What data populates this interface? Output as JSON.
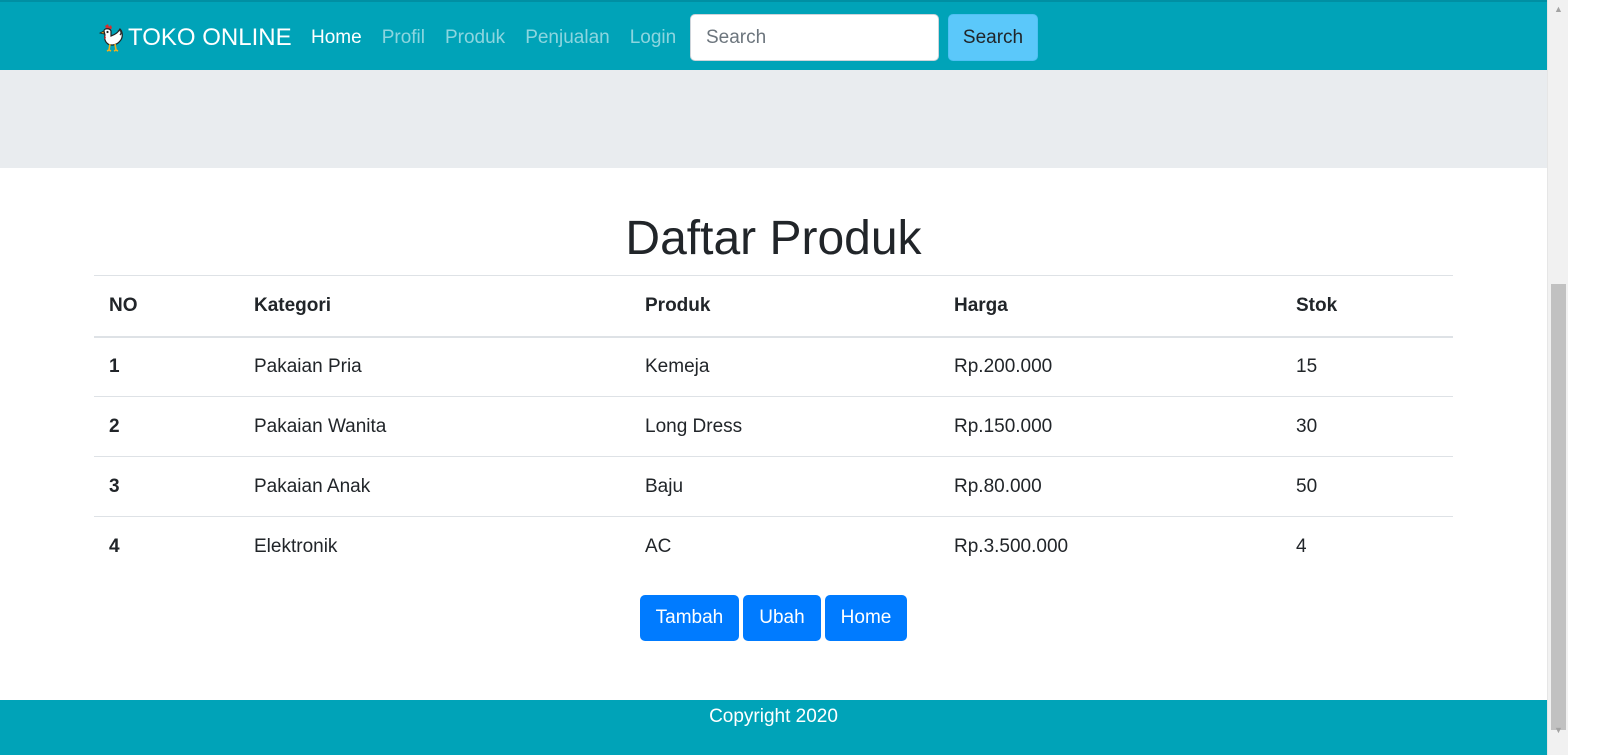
{
  "navbar": {
    "brand": "TOKO ONLINE",
    "logo_icon": "rooster-icon",
    "links": [
      {
        "label": "Home",
        "active": true
      },
      {
        "label": "Profil",
        "active": false
      },
      {
        "label": "Produk",
        "active": false
      },
      {
        "label": "Penjualan",
        "active": false
      },
      {
        "label": "Login",
        "active": false
      }
    ],
    "search_placeholder": "Search",
    "search_value": "",
    "search_button": "Search"
  },
  "main": {
    "title": "Daftar Produk",
    "table": {
      "headers": [
        "NO",
        "Kategori",
        "Produk",
        "Harga",
        "Stok"
      ],
      "rows": [
        [
          "1",
          "Pakaian Pria",
          "Kemeja",
          "Rp.200.000",
          "15"
        ],
        [
          "2",
          "Pakaian Wanita",
          "Long Dress",
          "Rp.150.000",
          "30"
        ],
        [
          "3",
          "Pakaian Anak",
          "Baju",
          "Rp.80.000",
          "50"
        ],
        [
          "4",
          "Elektronik",
          "AC",
          "Rp.3.500.000",
          "4"
        ]
      ]
    },
    "buttons": {
      "tambah": "Tambah",
      "ubah": "Ubah",
      "home": "Home"
    }
  },
  "footer": {
    "text": "Copyright 2020"
  },
  "colors": {
    "navbar_bg": "#00a3b8",
    "jumbotron_bg": "#e9ecef",
    "primary_button": "#007bff",
    "search_button": "#5bc8fa",
    "footer_bg": "#00a3b8"
  }
}
